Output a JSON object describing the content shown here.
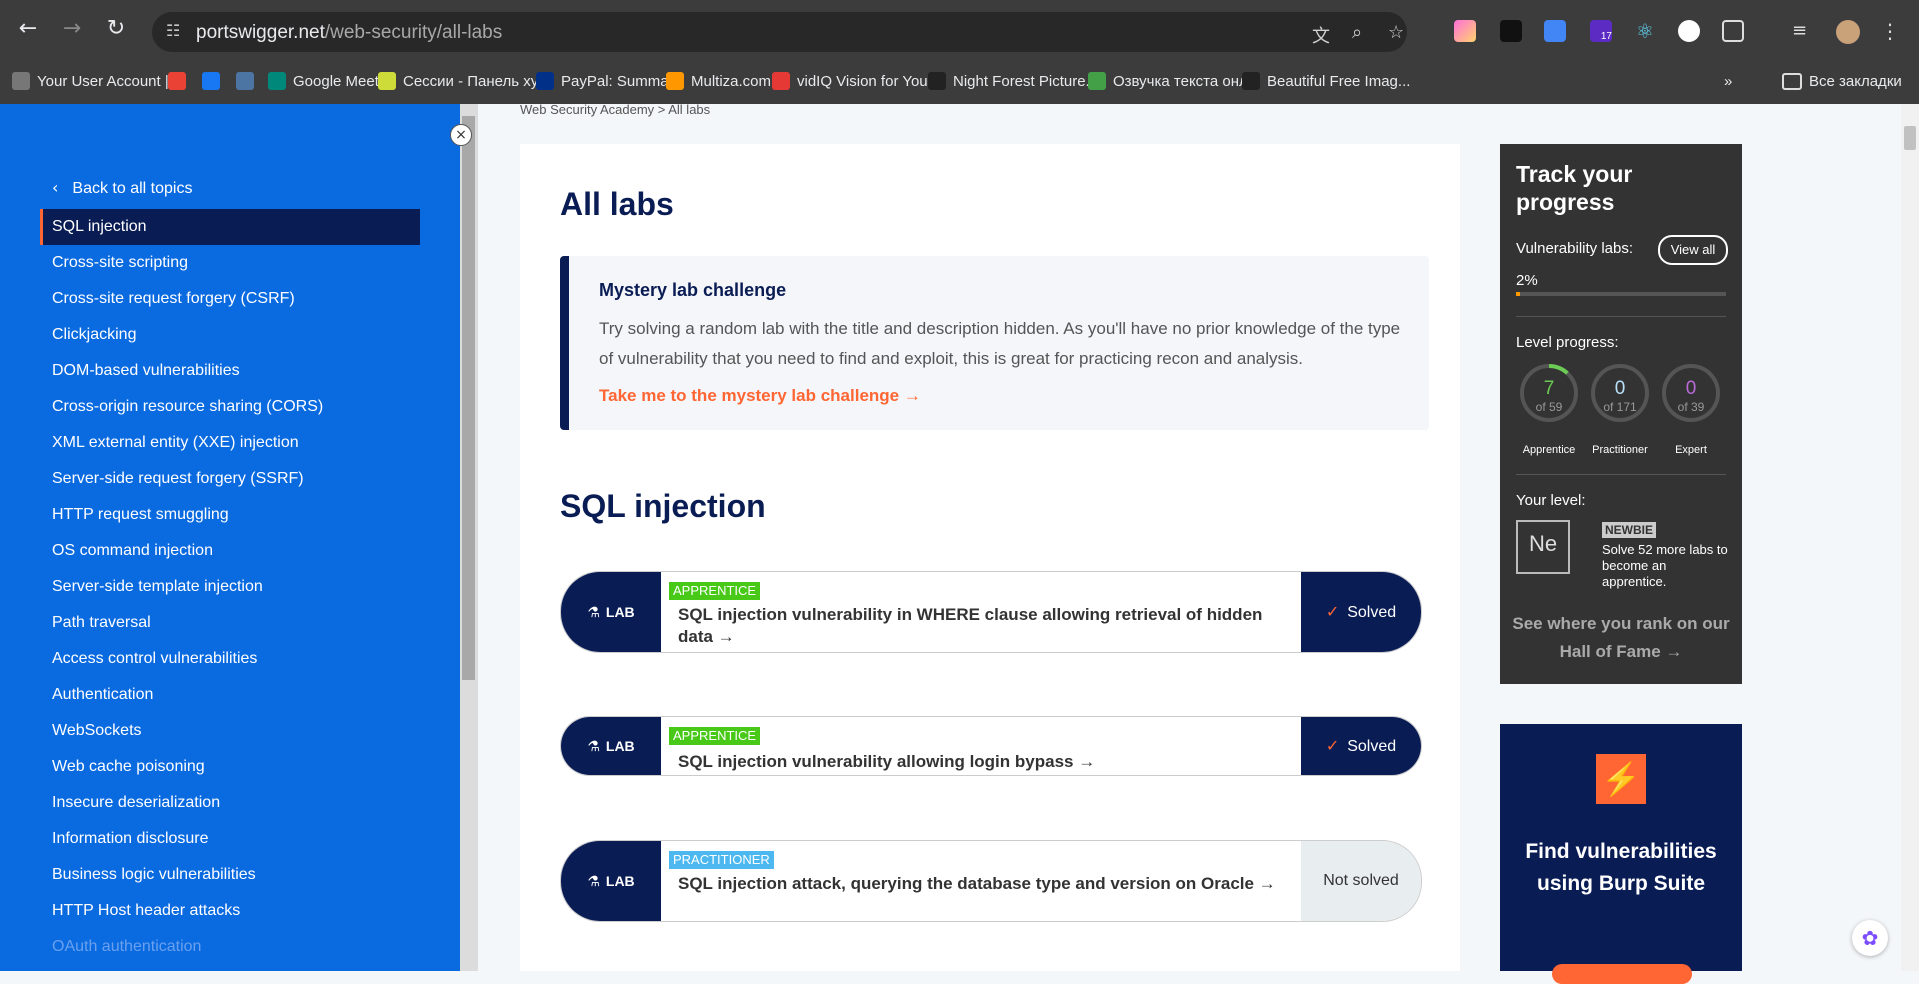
{
  "browser": {
    "url_host": "portswigger.net",
    "url_path": "/web-security/all-labs",
    "back_icon": "←",
    "forward_icon": "→",
    "reload_icon": "↻",
    "extension_badge": "17"
  },
  "bookmarks": [
    {
      "label": "Your User Account |...",
      "color": "#777777"
    },
    {
      "label": "",
      "color": "#ea4335"
    },
    {
      "label": "",
      "color": "#1877f2"
    },
    {
      "label": "",
      "color": "#4c75a3"
    },
    {
      "label": "Google Meet",
      "color": "#00897b"
    },
    {
      "label": "Сессии - Панель ху...",
      "color": "#cddc39"
    },
    {
      "label": "PayPal: Summary",
      "color": "#003087"
    },
    {
      "label": "Multiza.com",
      "color": "#ff9800"
    },
    {
      "label": "vidIQ Vision for You...",
      "color": "#e53935"
    },
    {
      "label": "Night Forest Picture...",
      "color": "#222222"
    },
    {
      "label": "Озвучка текста онл...",
      "color": "#43a047"
    },
    {
      "label": "Beautiful Free Imag...",
      "color": "#222222"
    }
  ],
  "bookmarks_overflow": "»",
  "all_bookmarks": "Все закладки",
  "sidebar": {
    "close": "×",
    "back_label": "Back to all topics",
    "topics": [
      {
        "label": "SQL injection",
        "active": true
      },
      {
        "label": "Cross-site scripting"
      },
      {
        "label": "Cross-site request forgery (CSRF)"
      },
      {
        "label": "Clickjacking"
      },
      {
        "label": "DOM-based vulnerabilities"
      },
      {
        "label": "Cross-origin resource sharing (CORS)"
      },
      {
        "label": "XML external entity (XXE) injection"
      },
      {
        "label": "Server-side request forgery (SSRF)"
      },
      {
        "label": "HTTP request smuggling"
      },
      {
        "label": "OS command injection"
      },
      {
        "label": "Server-side template injection"
      },
      {
        "label": "Path traversal"
      },
      {
        "label": "Access control vulnerabilities"
      },
      {
        "label": "Authentication"
      },
      {
        "label": "WebSockets"
      },
      {
        "label": "Web cache poisoning"
      },
      {
        "label": "Insecure deserialization"
      },
      {
        "label": "Information disclosure"
      },
      {
        "label": "Business logic vulnerabilities"
      },
      {
        "label": "HTTP Host header attacks"
      },
      {
        "label": "OAuth authentication",
        "faded": true
      }
    ]
  },
  "main": {
    "breadcrumb": "Web Security Academy  >  All labs",
    "title": "All labs",
    "mystery": {
      "title": "Mystery lab challenge",
      "description": "Try solving a random lab with the title and description hidden. As you'll have no prior knowledge of the type of vulnerability that you need to find and exploit, this is great for practicing recon and analysis.",
      "link": "Take me to the mystery lab challenge →"
    },
    "section_title": "SQL injection",
    "lab_tag": "LAB",
    "labs": [
      {
        "level": "APPRENTICE",
        "title": "SQL injection vulnerability in WHERE clause allowing retrieval of hidden data →",
        "status": "Solved",
        "solved": true
      },
      {
        "level": "APPRENTICE",
        "title": "SQL injection vulnerability allowing login bypass →",
        "status": "Solved",
        "solved": true
      },
      {
        "level": "PRACTITIONER",
        "title": "SQL injection attack, querying the database type and version on Oracle →",
        "status": "Not solved",
        "solved": false
      }
    ]
  },
  "progress": {
    "title": "Track your progress",
    "vuln_label": "Vulnerability labs:",
    "view_all": "View all",
    "percent": "2%",
    "percent_value": 0.02,
    "level_label": "Level progress:",
    "levels": [
      {
        "name": "Apprentice",
        "done": "7",
        "of": "of 59",
        "fraction": 0.119,
        "color": "#6ccb55"
      },
      {
        "name": "Practitioner",
        "done": "0",
        "of": "of 171",
        "fraction": 0,
        "color": "#b8e0f8"
      },
      {
        "name": "Expert",
        "done": "0",
        "of": "of 39",
        "fraction": 0,
        "color": "#b86ad8"
      }
    ],
    "your_level": "Your level:",
    "badge": "Ne",
    "level_name": "NEWBIE",
    "level_note": "Solve 52 more labs to become an apprentice.",
    "hall_of_fame": "See where you rank on our Hall of Fame →"
  },
  "promo": {
    "logo": "⚡",
    "text": "Find vulnerabilities using Burp Suite"
  }
}
